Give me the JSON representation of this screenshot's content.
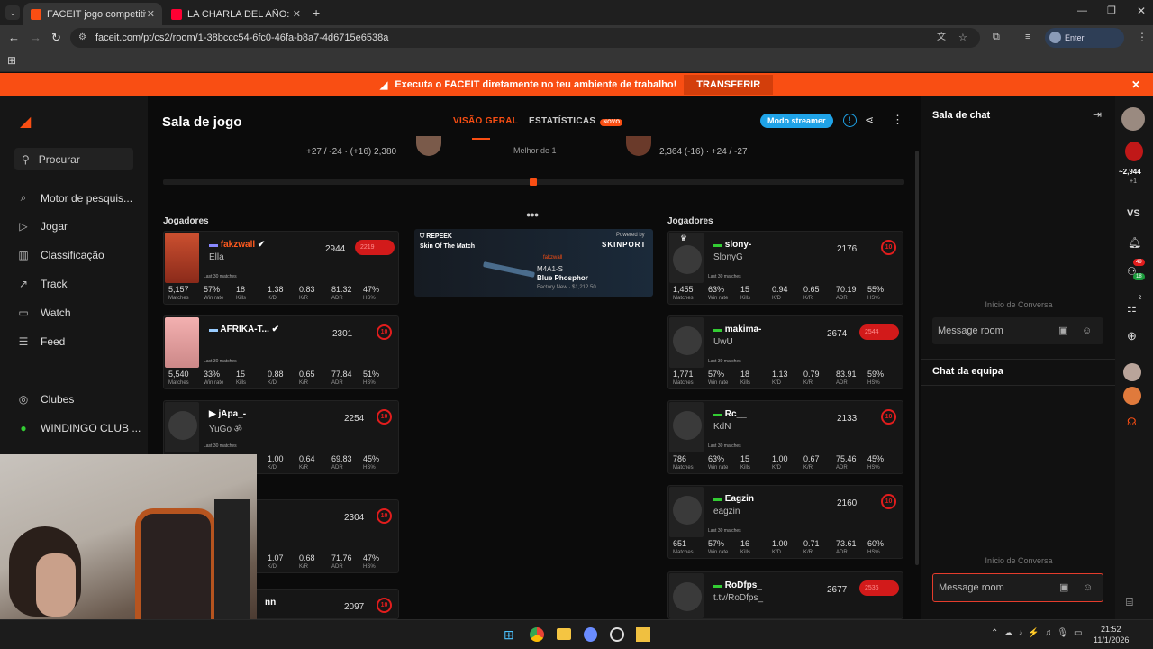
{
  "browser": {
    "tabs": [
      {
        "title": "FACEIT jogo competitivo - F",
        "active": true,
        "favicon_color": "#f94e13"
      },
      {
        "title": "LA CHARLA DEL AÑO: MESSI E",
        "active": false,
        "favicon_color": "#ff0033"
      }
    ],
    "url": "faceit.com/pt/cs2/room/1-38bccc54-6fc0-46fa-b8a7-4d6715e6538a",
    "passphrase_label": "Enter passphrase"
  },
  "banner": {
    "text": "Executa o FACEIT diretamente no teu ambiente de trabalho!",
    "button": "TRANSFERIR"
  },
  "sidebar": {
    "search": "Procurar",
    "items": [
      {
        "label": "Motor de pesquis...",
        "icon": "search-engine-icon"
      },
      {
        "label": "Jogar",
        "icon": "play-icon"
      },
      {
        "label": "Classificação",
        "icon": "ranking-icon"
      },
      {
        "label": "Track",
        "icon": "track-icon"
      },
      {
        "label": "Watch",
        "icon": "watch-icon"
      },
      {
        "label": "Feed",
        "icon": "feed-icon"
      },
      {
        "label": "Clubes",
        "icon": "clubs-icon"
      },
      {
        "label": "WINDINGO CLUB ...",
        "icon": "club-logo-icon"
      }
    ]
  },
  "room": {
    "title": "Sala de jogo",
    "tabs": [
      {
        "label": "VISÃO GERAL",
        "active": true
      },
      {
        "label": "ESTATÍSTICAS",
        "badge": "NOVO"
      }
    ],
    "streamer_button": "Modo streamer",
    "score_left": "+27 / -24 · (+16) 2,380",
    "score_right": "2,364 (-16) · +24 / -27",
    "best_of": "Melhor de 1",
    "players_header": "Jogadores",
    "stat_labels": [
      "Matches",
      "Win rate",
      "Kills",
      "K/D",
      "K/R",
      "ADR",
      "HS%"
    ],
    "last30": "Last 30 matches",
    "team_left": [
      {
        "name": "fakzwall",
        "sub": "Ella",
        "elo": "2944",
        "level": "2219",
        "stats": [
          "5,157",
          "57%",
          "18",
          "1.38",
          "0.83",
          "81.32",
          "47%"
        ],
        "accent": "#ff5a1f"
      },
      {
        "name": "AFRIKA-T...",
        "sub": "",
        "elo": "2301",
        "level": "10",
        "stats": [
          "5,540",
          "33%",
          "15",
          "0.88",
          "0.65",
          "77.84",
          "51%"
        ],
        "accent": "#fff"
      },
      {
        "name": "jApa_-",
        "sub": "YuGo ॐ",
        "elo": "2254",
        "level": "10",
        "stats": [
          "",
          "",
          "",
          "1.00",
          "0.64",
          "69.83",
          "45%"
        ],
        "accent": "#fff"
      },
      {
        "name": "",
        "sub": "",
        "elo": "2304",
        "level": "10",
        "stats": [
          "",
          "",
          "",
          "1.07",
          "0.68",
          "71.76",
          "47%"
        ],
        "accent": "#fff"
      },
      {
        "name": "nn",
        "sub": "",
        "elo": "2097",
        "level": "10",
        "stats": [],
        "accent": "#fff"
      }
    ],
    "team_right": [
      {
        "name": "slony-",
        "sub": "SlonyG",
        "elo": "2176",
        "level": "10",
        "stats": [
          "1,455",
          "63%",
          "15",
          "0.94",
          "0.65",
          "70.19",
          "55%"
        ]
      },
      {
        "name": "makima-",
        "sub": "UwU",
        "elo": "2674",
        "level": "2544",
        "stats": [
          "1,771",
          "57%",
          "18",
          "1.13",
          "0.79",
          "83.91",
          "59%"
        ]
      },
      {
        "name": "Rc__",
        "sub": "KdN",
        "elo": "2133",
        "level": "10",
        "stats": [
          "786",
          "63%",
          "15",
          "1.00",
          "0.67",
          "75.46",
          "45%"
        ]
      },
      {
        "name": "Eagzin",
        "sub": "eagzin",
        "elo": "2160",
        "level": "10",
        "stats": [
          "651",
          "57%",
          "16",
          "1.00",
          "0.71",
          "73.61",
          "60%"
        ]
      },
      {
        "name": "RoDfps_",
        "sub": "t.tv/RoDfps_",
        "elo": "2677",
        "level": "2536",
        "stats": []
      }
    ],
    "skin_card": {
      "team": "REPEEK",
      "title": "Skin Of The Match",
      "powered": "Powered by",
      "brand": "SKINPORT",
      "owner": "fakzwall",
      "weapon": "M4A1-S",
      "skin": "Blue Phosphor",
      "price": "Factory New · $1,212.50"
    }
  },
  "chat": {
    "room_title": "Sala de chat",
    "conversation_start": "Início de Conversa",
    "placeholder": "Message room",
    "team_title": "Chat da equipa"
  },
  "rightbar": {
    "elo": "~2,944",
    "elo_delta": "+1",
    "vs": "VS",
    "badge1": "49",
    "badge2": "18",
    "badge3": "2"
  },
  "taskbar": {
    "time": "21:52",
    "date": "11/1/2026"
  }
}
